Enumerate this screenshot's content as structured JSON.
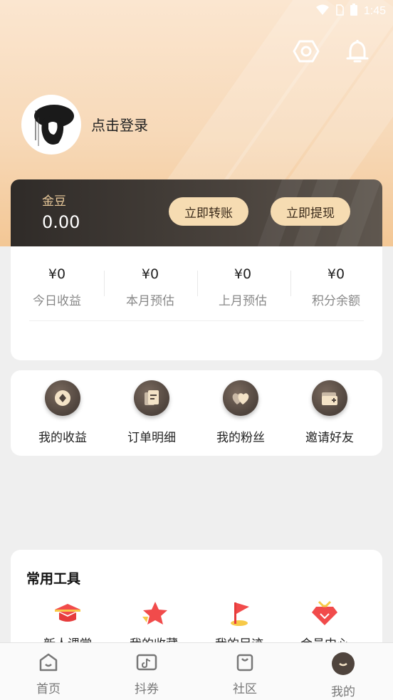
{
  "status": {
    "time": "1:45"
  },
  "header": {
    "settings_icon": "settings-hex-icon",
    "bell_icon": "bell-icon"
  },
  "profile": {
    "login_text": "点击登录"
  },
  "gold": {
    "label": "金豆",
    "value": "0.00",
    "transfer_button": "立即转账",
    "withdraw_button": "立即提现"
  },
  "stats": [
    {
      "value": "¥0",
      "label": "今日收益"
    },
    {
      "value": "¥0",
      "label": "本月预估"
    },
    {
      "value": "¥0",
      "label": "上月预估"
    },
    {
      "value": "¥0",
      "label": "积分余额"
    }
  ],
  "functions": [
    {
      "label": "我的收益",
      "icon": "coin-icon"
    },
    {
      "label": "订单明细",
      "icon": "order-icon"
    },
    {
      "label": "我的粉丝",
      "icon": "fans-icon"
    },
    {
      "label": "邀请好友",
      "icon": "invite-icon"
    }
  ],
  "tools": {
    "title": "常用工具",
    "items": [
      {
        "label": "新人课堂",
        "icon": "graduation-cap-icon"
      },
      {
        "label": "我的收藏",
        "icon": "star-icon"
      },
      {
        "label": "我的足迹",
        "icon": "flag-icon"
      },
      {
        "label": "会员中心",
        "icon": "diamond-icon"
      }
    ]
  },
  "tabbar": [
    {
      "label": "首页",
      "icon": "home-icon"
    },
    {
      "label": "抖券",
      "icon": "coupon-icon"
    },
    {
      "label": "社区",
      "icon": "bag-icon"
    },
    {
      "label": "我的",
      "icon": "profile-icon"
    }
  ],
  "colors": {
    "accent": "#f6dcb2",
    "card_dark": "#3a3430",
    "hero_top": "#fbe6d0"
  }
}
